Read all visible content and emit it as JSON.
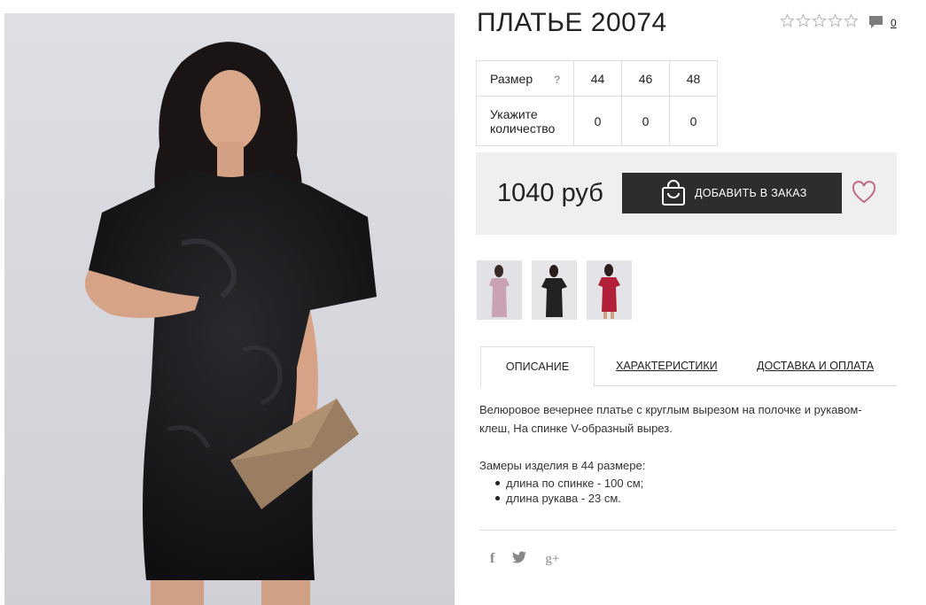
{
  "product": {
    "title": "ПЛАТЬЕ 20074",
    "rating": {
      "value": 0,
      "max": 5
    },
    "comments_count": "0"
  },
  "sizes": {
    "label": "Размер",
    "help": "?",
    "values": [
      "44",
      "46",
      "48"
    ],
    "qty_label_line1": "Укажите",
    "qty_label_line2": "количество",
    "quantities": [
      "0",
      "0",
      "0"
    ]
  },
  "buy": {
    "price": "1040 руб",
    "add_label": "ДОБАВИТЬ В ЗАКАЗ"
  },
  "tabs": [
    {
      "label": "ОПИСАНИЕ",
      "active": true
    },
    {
      "label": "ХАРАКТЕРИСТИКИ",
      "active": false
    },
    {
      "label": "ДОСТАВКА И ОПЛАТА",
      "active": false
    }
  ],
  "description": {
    "text": "Велюровое вечернее платье с круглым вырезом на полочке и рукавом-клеш, На спинке V-образный вырез.",
    "measure_title": "Замеры изделия в 44 размере:",
    "measures": [
      "длина по спинке - 100 см;",
      "длина рукава - 23 см."
    ]
  },
  "social": {
    "facebook": "f",
    "twitter": "t",
    "google": "g+"
  },
  "colors": {
    "dark_button": "#2d2d2d",
    "buy_box_bg": "#efefef",
    "heart": "#c06a8a",
    "border": "#dedede"
  },
  "icons": [
    "star-icon",
    "comment-icon",
    "question-icon",
    "shopping-bag-icon",
    "heart-icon",
    "facebook-icon",
    "twitter-icon",
    "google-plus-icon"
  ]
}
